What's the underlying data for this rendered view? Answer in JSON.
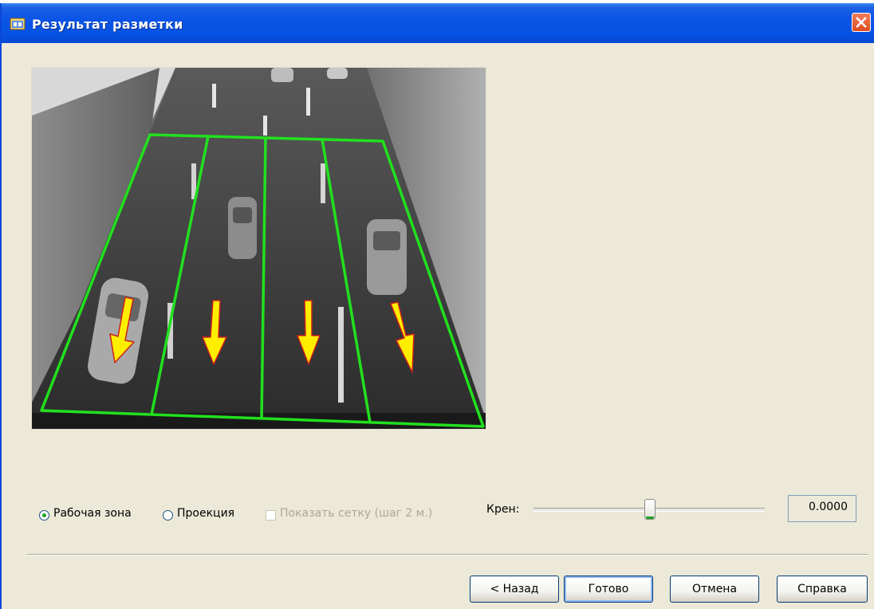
{
  "window": {
    "title": "Результат разметки",
    "title_icon": "dialog-app-icon",
    "close_icon": "close-icon"
  },
  "preview": {
    "content": "grayscale overhead traffic camera image with green lane markup and yellow direction arrows",
    "zone_color": "#22e01e",
    "arrow_color": "#ffee00",
    "arrow_outline": "#cc1f1f",
    "lanes": 4
  },
  "options": {
    "work_zone_label": "Рабочая зона",
    "work_zone_selected": true,
    "projection_label": "Проекция",
    "projection_selected": false,
    "grid_label": "Показать сетку (шаг 2 м.)",
    "grid_checked": false,
    "grid_enabled": false
  },
  "roll": {
    "label": "Крен:",
    "value": "0.0000",
    "slider_level": 0.5
  },
  "buttons": {
    "back": "< Назад",
    "finish": "Готово",
    "cancel": "Отмена",
    "help": "Справка"
  },
  "colors": {
    "title_bar": "#0753e3",
    "dialog_bg": "#ece9d8",
    "close_button": "#de4b1f",
    "radio_dot": "#21a121"
  }
}
